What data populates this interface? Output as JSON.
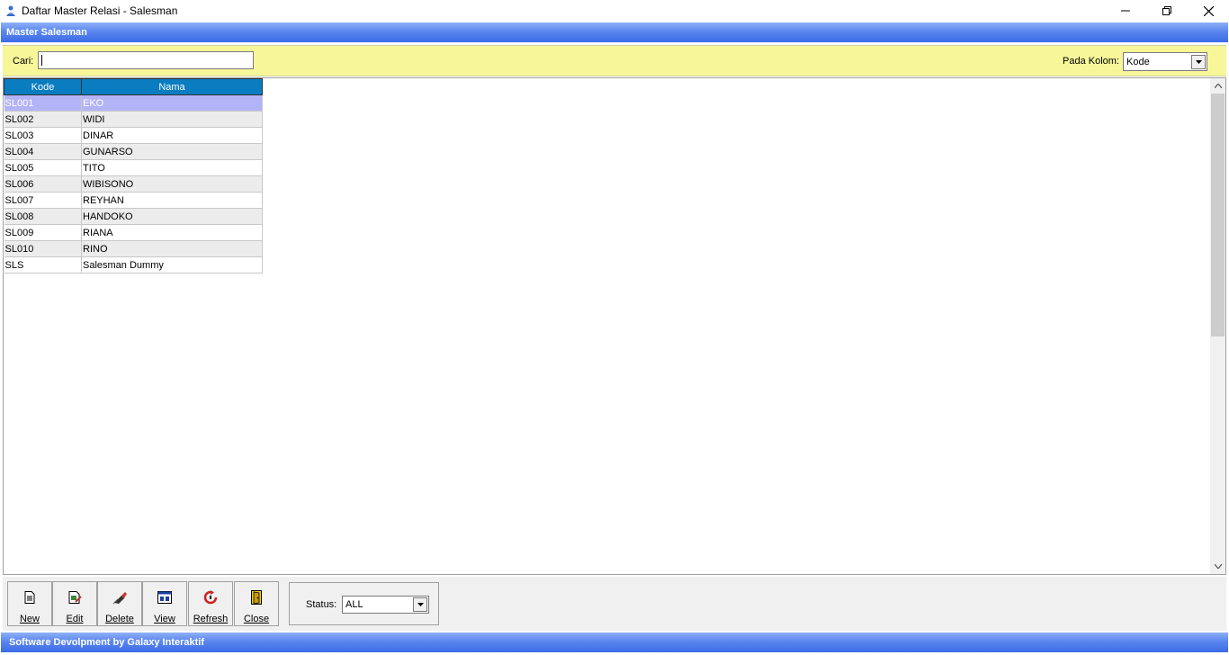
{
  "window": {
    "title": "Daftar Master Relasi - Salesman",
    "icon": "app-person-icon"
  },
  "header": {
    "title": "Master Salesman"
  },
  "search": {
    "label": "Cari:",
    "value": "",
    "column_label": "Pada Kolom:",
    "column_value": "Kode"
  },
  "grid": {
    "columns": [
      "Kode",
      "Nama"
    ],
    "selected_row": 0,
    "rows": [
      {
        "kode": "SL001",
        "nama": "EKO"
      },
      {
        "kode": "SL002",
        "nama": "WIDI"
      },
      {
        "kode": "SL003",
        "nama": "DINAR"
      },
      {
        "kode": "SL004",
        "nama": "GUNARSO"
      },
      {
        "kode": "SL005",
        "nama": "TITO"
      },
      {
        "kode": "SL006",
        "nama": "WIBISONO"
      },
      {
        "kode": "SL007",
        "nama": "REYHAN"
      },
      {
        "kode": "SL008",
        "nama": "HANDOKO"
      },
      {
        "kode": "SL009",
        "nama": "RIANA"
      },
      {
        "kode": "SL010",
        "nama": "RINO"
      },
      {
        "kode": "SLS",
        "nama": "Salesman Dummy"
      }
    ]
  },
  "toolbar": {
    "buttons": [
      {
        "label": "New",
        "icon": "new-document-icon"
      },
      {
        "label": "Edit",
        "icon": "edit-document-icon"
      },
      {
        "label": "Delete",
        "icon": "delete-eraser-icon"
      },
      {
        "label": "View",
        "icon": "view-window-icon"
      },
      {
        "label": "Refresh",
        "icon": "refresh-icon"
      },
      {
        "label": "Close",
        "icon": "close-door-icon"
      }
    ],
    "status_label": "Status:",
    "status_value": "ALL"
  },
  "footer": {
    "text": "Software Devolpment by Galaxy Interaktif"
  },
  "colors": {
    "header_blue": "#3b6be6",
    "search_yellow": "#f7f79a",
    "grid_header": "#0a7cc0",
    "selected_row": "#b3b3f7"
  }
}
